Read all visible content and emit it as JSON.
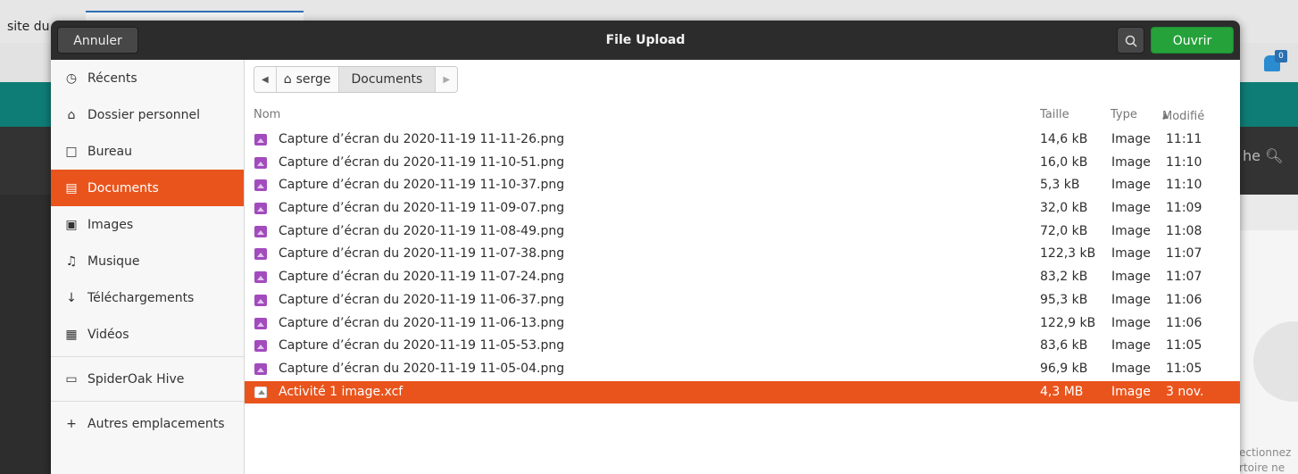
{
  "background": {
    "site_tab_text": "site du",
    "search_fragment": "he",
    "badge_count": "0",
    "right_text_1": "ectionnez",
    "right_text_2": "rtoire ne"
  },
  "dialog": {
    "title": "File Upload",
    "cancel_label": "Annuler",
    "open_label": "Ouvrir",
    "accent_color": "#e9541d",
    "open_color": "#25a23a"
  },
  "sidebar": {
    "items": [
      {
        "label": "Récents",
        "icon": "clock-icon"
      },
      {
        "label": "Dossier personnel",
        "icon": "home-icon"
      },
      {
        "label": "Bureau",
        "icon": "desktop-icon"
      },
      {
        "label": "Documents",
        "icon": "document-icon",
        "active": true
      },
      {
        "label": "Images",
        "icon": "image-icon"
      },
      {
        "label": "Musique",
        "icon": "music-icon"
      },
      {
        "label": "Téléchargements",
        "icon": "download-icon"
      },
      {
        "label": "Vidéos",
        "icon": "video-icon"
      },
      {
        "label": "SpiderOak Hive",
        "icon": "folder-icon"
      },
      {
        "label": "Autres emplacements",
        "icon": "plus-icon"
      }
    ]
  },
  "pathbar": {
    "home": "serge",
    "current": "Documents"
  },
  "columns": {
    "name": "Nom",
    "size": "Taille",
    "type": "Type",
    "modified": "Modifié"
  },
  "files": [
    {
      "name": "Capture d’écran du 2020-11-19 11-11-26.png",
      "size": "14,6 kB",
      "type": "Image",
      "modified": "11:11"
    },
    {
      "name": "Capture d’écran du 2020-11-19 11-10-51.png",
      "size": "16,0 kB",
      "type": "Image",
      "modified": "11:10"
    },
    {
      "name": "Capture d’écran du 2020-11-19 11-10-37.png",
      "size": "5,3 kB",
      "type": "Image",
      "modified": "11:10"
    },
    {
      "name": "Capture d’écran du 2020-11-19 11-09-07.png",
      "size": "32,0 kB",
      "type": "Image",
      "modified": "11:09"
    },
    {
      "name": "Capture d’écran du 2020-11-19 11-08-49.png",
      "size": "72,0 kB",
      "type": "Image",
      "modified": "11:08"
    },
    {
      "name": "Capture d’écran du 2020-11-19 11-07-38.png",
      "size": "122,3 kB",
      "type": "Image",
      "modified": "11:07"
    },
    {
      "name": "Capture d’écran du 2020-11-19 11-07-24.png",
      "size": "83,2 kB",
      "type": "Image",
      "modified": "11:07"
    },
    {
      "name": "Capture d’écran du 2020-11-19 11-06-37.png",
      "size": "95,3 kB",
      "type": "Image",
      "modified": "11:06"
    },
    {
      "name": "Capture d’écran du 2020-11-19 11-06-13.png",
      "size": "122,9 kB",
      "type": "Image",
      "modified": "11:06"
    },
    {
      "name": "Capture d’écran du 2020-11-19 11-05-53.png",
      "size": "83,6 kB",
      "type": "Image",
      "modified": "11:05"
    },
    {
      "name": "Capture d’écran du 2020-11-19 11-05-04.png",
      "size": "96,9 kB",
      "type": "Image",
      "modified": "11:05"
    },
    {
      "name": "Activité 1 image.xcf",
      "size": "4,3 MB",
      "type": "Image",
      "modified": "3 nov.",
      "selected": true
    }
  ]
}
